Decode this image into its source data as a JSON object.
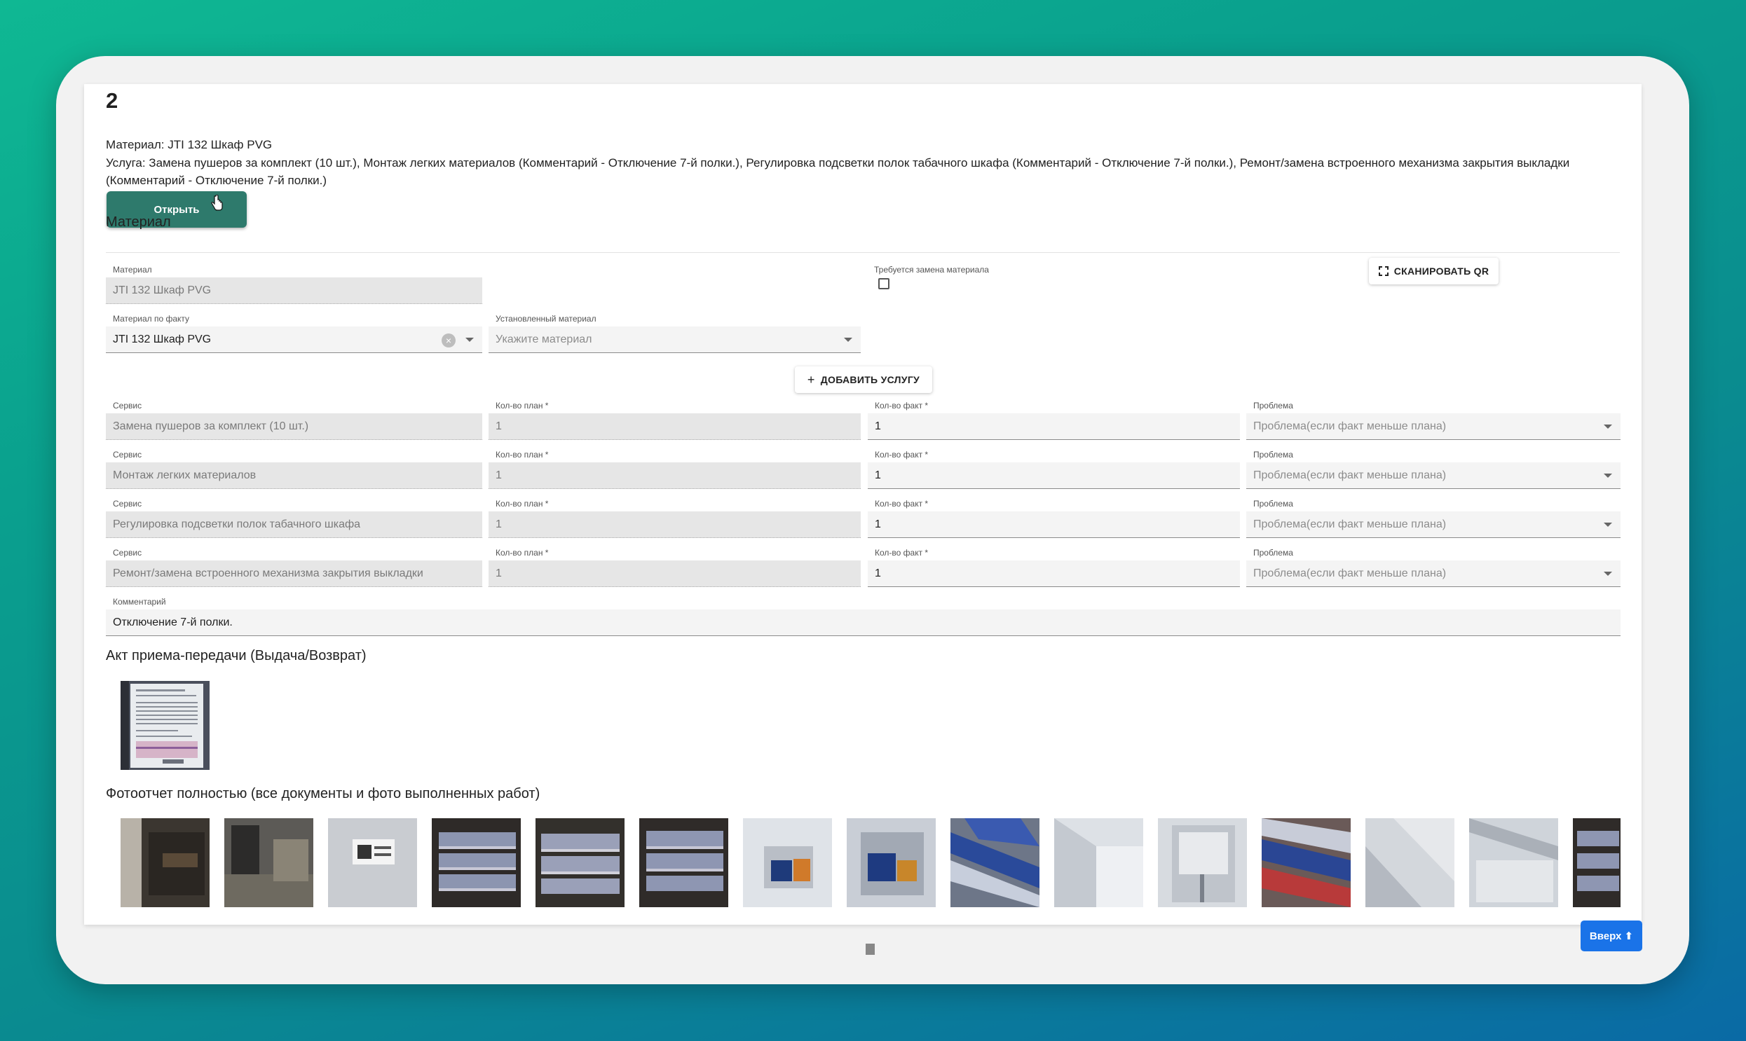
{
  "record": {
    "number": "2",
    "material_line": "Материал: JTI 132 Шкаф PVG",
    "service_line": "Услуга: Замена пушеров за комплект (10 шт.), Монтаж легких материалов (Комментарий - Отключение 7-й полки.), Регулировка подсветки полок табачного шкафа (Комментарий - Отключение 7-й полки.), Ремонт/замена встроенного механизма закрытия выкладки (Комментарий - Отключение 7-й полки.)",
    "open_button": "Открыть"
  },
  "material_section": {
    "title": "Материал",
    "material_label": "Материал",
    "material_value": "JTI 132 Шкаф PVG",
    "replace_required_label": "Требуется замена материала",
    "scan_qr_button": "СКАНИРОВАТЬ QR",
    "actual_material_label": "Материал по факту",
    "actual_material_value": "JTI 132 Шкаф PVG",
    "installed_material_label": "Установленный материал",
    "installed_material_placeholder": "Укажите материал",
    "add_service_button": "ДОБАВИТЬ УСЛУГУ"
  },
  "services": {
    "service_label": "Сервис",
    "plan_label": "Кол-во план *",
    "fact_label": "Кол-во факт *",
    "problem_label": "Проблема",
    "problem_placeholder": "Проблема(если факт меньше плана)",
    "rows": [
      {
        "service": "Замена пушеров за комплект (10 шт.)",
        "plan": "1",
        "fact": "1"
      },
      {
        "service": "Монтаж легких материалов",
        "plan": "1",
        "fact": "1"
      },
      {
        "service": "Регулировка подсветки полок табачного шкафа",
        "plan": "1",
        "fact": "1"
      },
      {
        "service": "Ремонт/замена встроенного механизма закрытия выкладки",
        "plan": "1",
        "fact": "1"
      }
    ],
    "comment_label": "Комментарий",
    "comment_value": "Отключение 7-й полки."
  },
  "act_section": {
    "title": "Акт приема-передачи (Выдача/Возврат)"
  },
  "photo_section": {
    "title": "Фотоотчет полностью (все документы и фото выполненных работ)"
  },
  "scroll_top_button": "Вверх ⬆",
  "colors": {
    "primary": "#2e7a6c",
    "accent": "#1a73e8"
  }
}
